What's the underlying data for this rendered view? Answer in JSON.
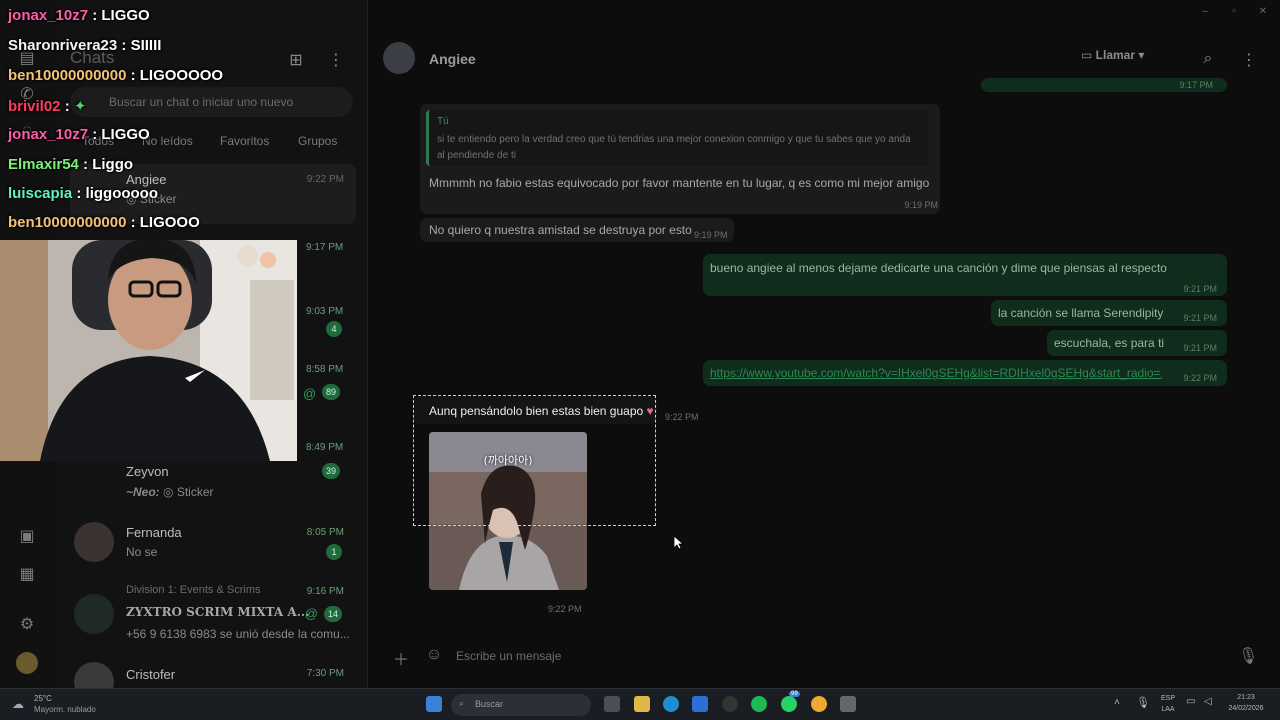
{
  "chat_list": {
    "title": "Chats",
    "search_placeholder": "Buscar un chat o iniciar uno nuevo",
    "filters": [
      "Todos",
      "No leídos",
      "Favoritos",
      "Grupos"
    ],
    "selected": {
      "name": "Angiee",
      "time": "9:22 PM",
      "preview": "Sticker"
    },
    "side_times": [
      "9:17 PM",
      "9:03 PM",
      "8:58 PM",
      "8:49 PM"
    ],
    "side_badges": [
      "4",
      "89",
      "39"
    ],
    "rows": [
      {
        "name": "Zeyvon",
        "sender": "~Neo:",
        "preview": "Sticker"
      },
      {
        "name": "Fernanda",
        "time": "8:05 PM",
        "preview": "No se",
        "badge": "1"
      },
      {
        "community": "Division 1: Events & Scrims",
        "name": "ZYXTRO SCRIM MIXTA A...",
        "time": "9:16 PM",
        "preview": "+56 9 6138 6983 se unió desde la comu...",
        "badge": "14"
      },
      {
        "name": "Cristofer",
        "time": "7:30 PM"
      }
    ]
  },
  "header": {
    "contact": "Angiee",
    "call_label": "Llamar"
  },
  "messages": {
    "top_time": "9:17 PM",
    "quoted_author": "Tú",
    "quoted_text": "si te entiendo pero la verdad creo que tú tendrias una mejor conexion conmigo y que tu sabes que yo anda al pendiende de ti",
    "m1_text": "Mmmmh no fabio estas equivocado por favor mantente en tu lugar, q es como mi mejor amigo",
    "m1_time": "9:19 PM",
    "m2_text": "No quiero q nuestra amistad se destruya por esto",
    "m2_time": "9:19 PM",
    "m3_text": "bueno angiee al menos dejame dedicarte una canción y dime que piensas al respecto",
    "m3_time": "9:21 PM",
    "m4_text": "la canción se llama Serendipity",
    "m4_time": "9:21 PM",
    "m5_text": "escuchala, es para ti",
    "m5_time": "9:21 PM",
    "m6_link": "https://www.youtube.com/watch?v=IHxel0gSEHg&list=RDIHxel0gSEHg&start_radio=1",
    "m6_time": "9:22 PM",
    "m7_text": "Aunq pensándolo bien estas bien guapo",
    "m7_time": "9:22 PM",
    "sticker_caption": "(까아아아)",
    "sticker_time": "9:22 PM"
  },
  "composer": {
    "placeholder": "Escribe un mensaje"
  },
  "taskbar": {
    "weather_temp": "25°C",
    "weather_desc": "Mayorm. nublado",
    "search_label": "Buscar",
    "lang_top": "ESP",
    "lang_bottom": "LAA",
    "clock_time": "21:23",
    "clock_date": "24/02/2026",
    "whatsapp_badge": "99"
  },
  "stream_chat": [
    {
      "user": "jonax_10z7",
      "color": "#ff5ca8",
      "text": " : LIGGO"
    },
    {
      "user": "Sharonrivera23",
      "color": "#f4f4f4",
      "text": " : SIIIII"
    },
    {
      "user": "ben10000000000",
      "color": "#f3c278",
      "text": " : LIGOOOOO"
    },
    {
      "user": "brivil02",
      "color": "#ff3b5c",
      "text": " : "
    },
    {
      "user": "jonax_10z7",
      "color": "#ff5ca8",
      "text": " : LIGGO"
    },
    {
      "user": "Elmaxir54",
      "color": "#7bf07a",
      "text": " : Liggo"
    },
    {
      "user": "luiscapia",
      "color": "#5ef2c8",
      "text": " : liggooooo"
    },
    {
      "user": "ben10000000000",
      "color": "#f3c278",
      "text": " : LIGOOO"
    }
  ],
  "colors": {
    "accent": "#2f7a49",
    "outgoing_bubble": "#0f2c1c",
    "incoming_bubble": "#1b1b1b"
  }
}
